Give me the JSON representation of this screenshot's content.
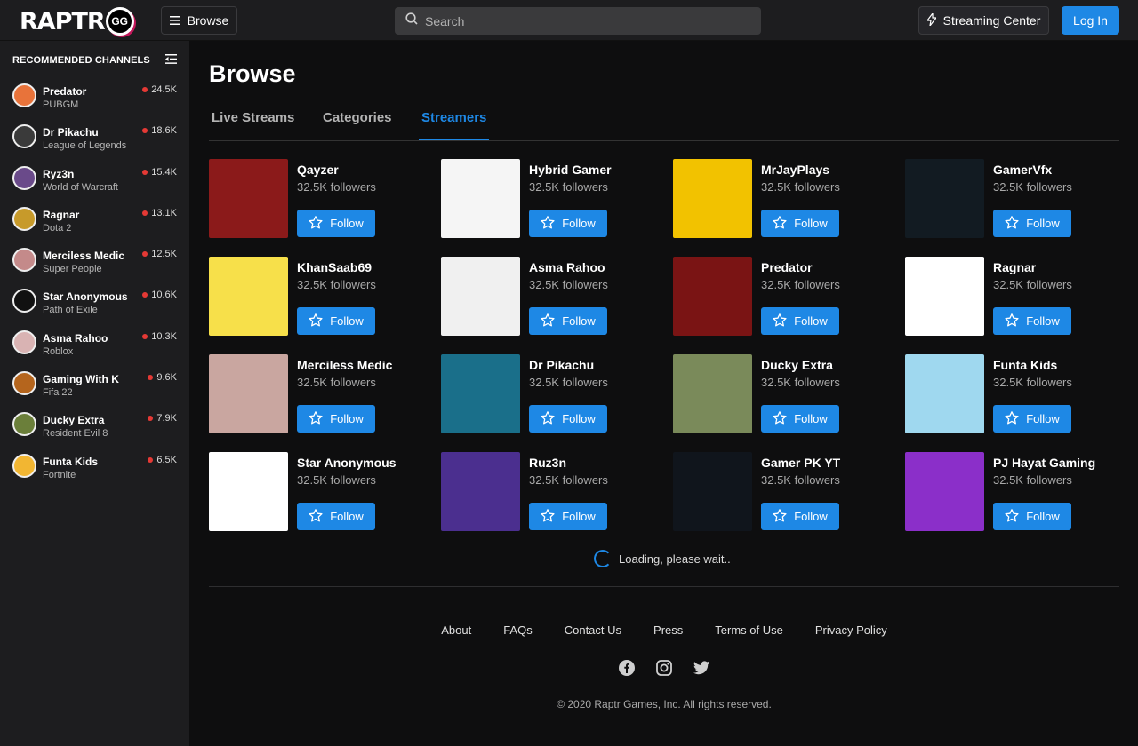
{
  "header": {
    "logo_text": "RAPTR",
    "logo_badge": "GG",
    "browse_label": "Browse",
    "search_placeholder": "Search",
    "streaming_center_label": "Streaming Center",
    "login_label": "Log In"
  },
  "sidebar": {
    "title": "RECOMMENDED CHANNELS",
    "channels": [
      {
        "name": "Predator",
        "game": "PUBGM",
        "viewers": "24.5K",
        "color": "#e8733a"
      },
      {
        "name": "Dr Pikachu",
        "game": "League of Legends",
        "viewers": "18.6K",
        "color": "#3a3a3a"
      },
      {
        "name": "Ryz3n",
        "game": "World of Warcraft",
        "viewers": "15.4K",
        "color": "#6a4a8a"
      },
      {
        "name": "Ragnar",
        "game": "Dota 2",
        "viewers": "13.1K",
        "color": "#c79a2a"
      },
      {
        "name": "Merciless Medic",
        "game": "Super People",
        "viewers": "12.5K",
        "color": "#c48a8a"
      },
      {
        "name": "Star Anonymous",
        "game": "Path of Exile",
        "viewers": "10.6K",
        "color": "#111111"
      },
      {
        "name": "Asma Rahoo",
        "game": "Roblox",
        "viewers": "10.3K",
        "color": "#d9b3b3"
      },
      {
        "name": "Gaming With K",
        "game": "Fifa 22",
        "viewers": "9.6K",
        "color": "#b5651d"
      },
      {
        "name": "Ducky Extra",
        "game": "Resident Evil 8",
        "viewers": "7.9K",
        "color": "#6b7f3a"
      },
      {
        "name": "Funta Kids",
        "game": "Fortnite",
        "viewers": "6.5K",
        "color": "#f2b632"
      }
    ]
  },
  "main": {
    "title": "Browse",
    "tabs": [
      {
        "label": "Live Streams",
        "active": false
      },
      {
        "label": "Categories",
        "active": false
      },
      {
        "label": "Streamers",
        "active": true
      }
    ],
    "follow_label": "Follow",
    "streamers": [
      {
        "name": "Qayzer",
        "followers": "32.5K followers",
        "color": "#8b1a1a"
      },
      {
        "name": "Hybrid Gamer",
        "followers": "32.5K followers",
        "color": "#f5f5f5"
      },
      {
        "name": "MrJayPlays",
        "followers": "32.5K followers",
        "color": "#f2c200"
      },
      {
        "name": "GamerVfx",
        "followers": "32.5K followers",
        "color": "#121b22"
      },
      {
        "name": "KhanSaab69",
        "followers": "32.5K followers",
        "color": "#f7e04a"
      },
      {
        "name": "Asma Rahoo",
        "followers": "32.5K followers",
        "color": "#f0f0f0"
      },
      {
        "name": "Predator",
        "followers": "32.5K followers",
        "color": "#7a1414"
      },
      {
        "name": "Ragnar",
        "followers": "32.5K followers",
        "color": "#ffffff"
      },
      {
        "name": "Merciless Medic",
        "followers": "32.5K followers",
        "color": "#c9a6a0"
      },
      {
        "name": "Dr Pikachu",
        "followers": "32.5K followers",
        "color": "#1a6f8a"
      },
      {
        "name": "Ducky Extra",
        "followers": "32.5K followers",
        "color": "#7a8a5a"
      },
      {
        "name": "Funta Kids",
        "followers": "32.5K followers",
        "color": "#9fd8ef"
      },
      {
        "name": "Star Anonymous",
        "followers": "32.5K followers",
        "color": "#ffffff"
      },
      {
        "name": "Ruz3n",
        "followers": "32.5K followers",
        "color": "#4b2f8f"
      },
      {
        "name": "Gamer PK YT",
        "followers": "32.5K followers",
        "color": "#10151c"
      },
      {
        "name": "PJ Hayat Gaming",
        "followers": "32.5K followers",
        "color": "#8b2fc9"
      }
    ],
    "loading_text": "Loading, please wait.."
  },
  "footer": {
    "links": [
      "About",
      "FAQs",
      "Contact Us",
      "Press",
      "Terms of Use",
      "Privacy Policy"
    ],
    "socials": [
      "facebook-icon",
      "instagram-icon",
      "twitter-icon"
    ],
    "copyright": "© 2020 Raptr Games, Inc. All rights reserved."
  },
  "colors": {
    "accent": "#1e88e5",
    "live": "#e53935",
    "background": "#0e0e0f",
    "panel": "#1d1d1f"
  }
}
